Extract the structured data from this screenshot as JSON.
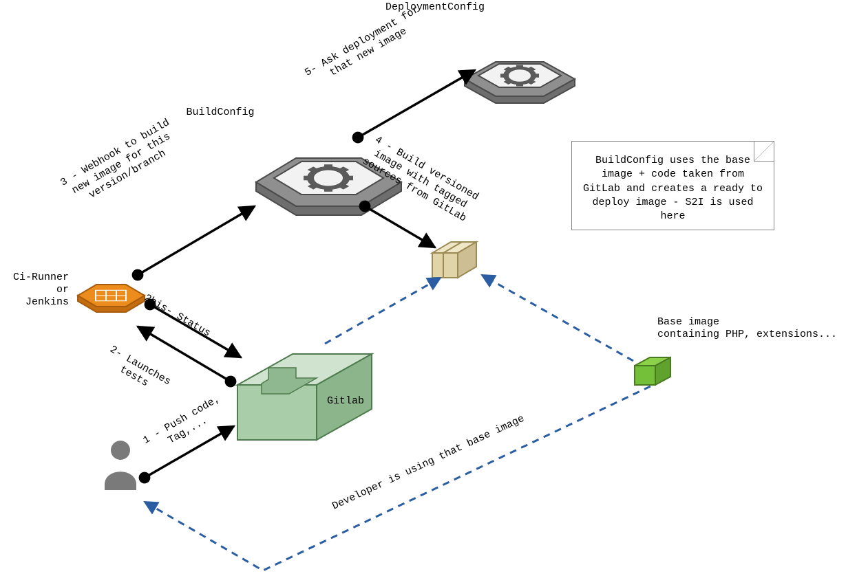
{
  "nodes": {
    "deploymentConfig": {
      "label": "DeploymentConfig"
    },
    "buildConfig": {
      "label": "BuildConfig"
    },
    "ciRunner": {
      "label": "Ci-Runner\nor\nJenkins"
    },
    "gitlab": {
      "label": "Gitlab"
    },
    "baseImage": {
      "label": "Base image\ncontaining PHP, extensions..."
    }
  },
  "edges": {
    "pushCode": {
      "label": "1 - Push code,\nTag,..."
    },
    "launches": {
      "label": "2- Launches\ntests"
    },
    "status": {
      "label": "2bis- Status"
    },
    "webhook": {
      "label": "3 - Webhook to build\nnew image for this\nversion/branch"
    },
    "buildVer": {
      "label": "4 - Build versioned\nimage with tagged\nsources from GitLab"
    },
    "askDeploy": {
      "label": "5- Ask deployment for\nthat new image"
    },
    "devUsing": {
      "label": "Developer is using that base image"
    }
  },
  "note": {
    "text": "BuildConfig uses the base\nimage + code taken from GitLab\nand creates a ready to deploy\nimage - S2I is used here"
  }
}
